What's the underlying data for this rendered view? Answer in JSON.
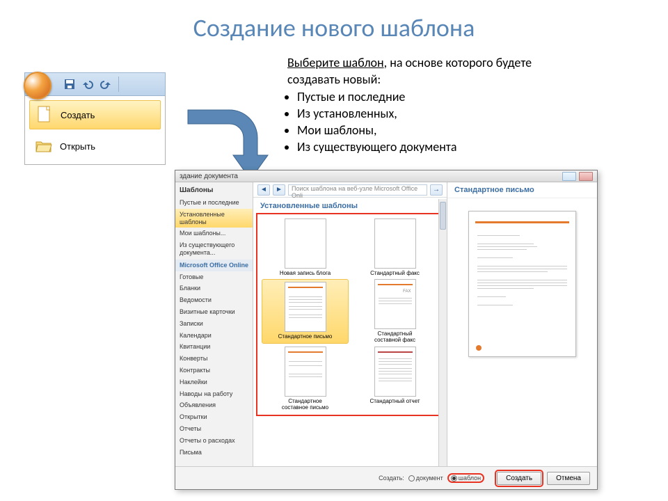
{
  "title": "Создание нового шаблона",
  "instruction": {
    "lead_underlined": "Выберите шаблон",
    "lead_rest": ", на основе которого будете создавать новый:",
    "bullets": [
      "Пустые и последние",
      "Из установленных,",
      "Мои шаблоны,",
      "Из существующего документа"
    ]
  },
  "office_menu": {
    "create": "Создать",
    "open": "Открыть"
  },
  "dialog": {
    "title_text": "здание документа",
    "sidebar": {
      "header": "Шаблоны",
      "top": [
        "Пустые и последние",
        "Установленные шаблоны",
        "Мои шаблоны...",
        "Из существующего документа..."
      ],
      "online_header": "Microsoft Office Online",
      "online": [
        "Готовые",
        "Бланки",
        "Ведомости",
        "Визитные карточки",
        "Записки",
        "Календари",
        "Квитанции",
        "Конверты",
        "Контракты",
        "Наклейки",
        "Наводы на работу",
        "Объявления",
        "Открытки",
        "Отчеты",
        "Отчеты о расходах",
        "Письма"
      ]
    },
    "search_placeholder": "Поиск шаблона на веб-узле Microsoft Office Onli",
    "center_heading": "Установленные шаблоны",
    "templates": [
      {
        "label": "Новая запись блога"
      },
      {
        "label": "Стандартный факс"
      },
      {
        "label": "Стандартное письмо",
        "selected": true,
        "fax": false
      },
      {
        "label": "Стандартный составной факс",
        "fax": true
      },
      {
        "label": "Стандартное составное письмо"
      },
      {
        "label": "Стандартный отчет"
      }
    ],
    "preview_title": "Стандартное письмо",
    "footer": {
      "create_as": "Создать:",
      "opt_doc": "документ",
      "opt_tpl": "шаблон",
      "btn_create": "Создать",
      "btn_cancel": "Отмена"
    }
  }
}
